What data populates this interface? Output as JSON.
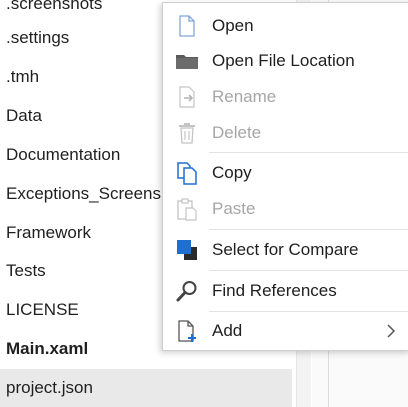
{
  "explorer": {
    "items": [
      {
        "label": ".screenshots",
        "bold": false,
        "selected": false
      },
      {
        "label": ".settings",
        "bold": false,
        "selected": false
      },
      {
        "label": ".tmh",
        "bold": false,
        "selected": false
      },
      {
        "label": "Data",
        "bold": false,
        "selected": false
      },
      {
        "label": "Documentation",
        "bold": false,
        "selected": false
      },
      {
        "label": "Exceptions_Screenshots",
        "bold": false,
        "selected": false
      },
      {
        "label": "Framework",
        "bold": false,
        "selected": false
      },
      {
        "label": "Tests",
        "bold": false,
        "selected": false
      },
      {
        "label": "LICENSE",
        "bold": false,
        "selected": false
      },
      {
        "label": "Main.xaml",
        "bold": true,
        "selected": false
      },
      {
        "label": "project.json",
        "bold": false,
        "selected": true
      }
    ]
  },
  "context_menu": {
    "items": [
      {
        "label": "Open",
        "icon": "document-icon",
        "enabled": true
      },
      {
        "label": "Open File Location",
        "icon": "folder-icon",
        "enabled": true
      },
      {
        "label": "Rename",
        "icon": "rename-icon",
        "enabled": false
      },
      {
        "label": "Delete",
        "icon": "trash-icon",
        "enabled": false
      },
      {
        "label": "Copy",
        "icon": "copy-icon",
        "enabled": true
      },
      {
        "label": "Paste",
        "icon": "paste-icon",
        "enabled": false
      },
      {
        "label": "Select for Compare",
        "icon": "compare-icon",
        "enabled": true
      },
      {
        "label": "Find References",
        "icon": "search-icon",
        "enabled": true
      },
      {
        "label": "Add",
        "icon": "add-document-icon",
        "enabled": true,
        "has_submenu": true
      }
    ]
  },
  "colors": {
    "accent_blue": "#1f6fd1",
    "disabled_gray": "#a6a6a6",
    "selected_row": "#e9e9e9"
  }
}
